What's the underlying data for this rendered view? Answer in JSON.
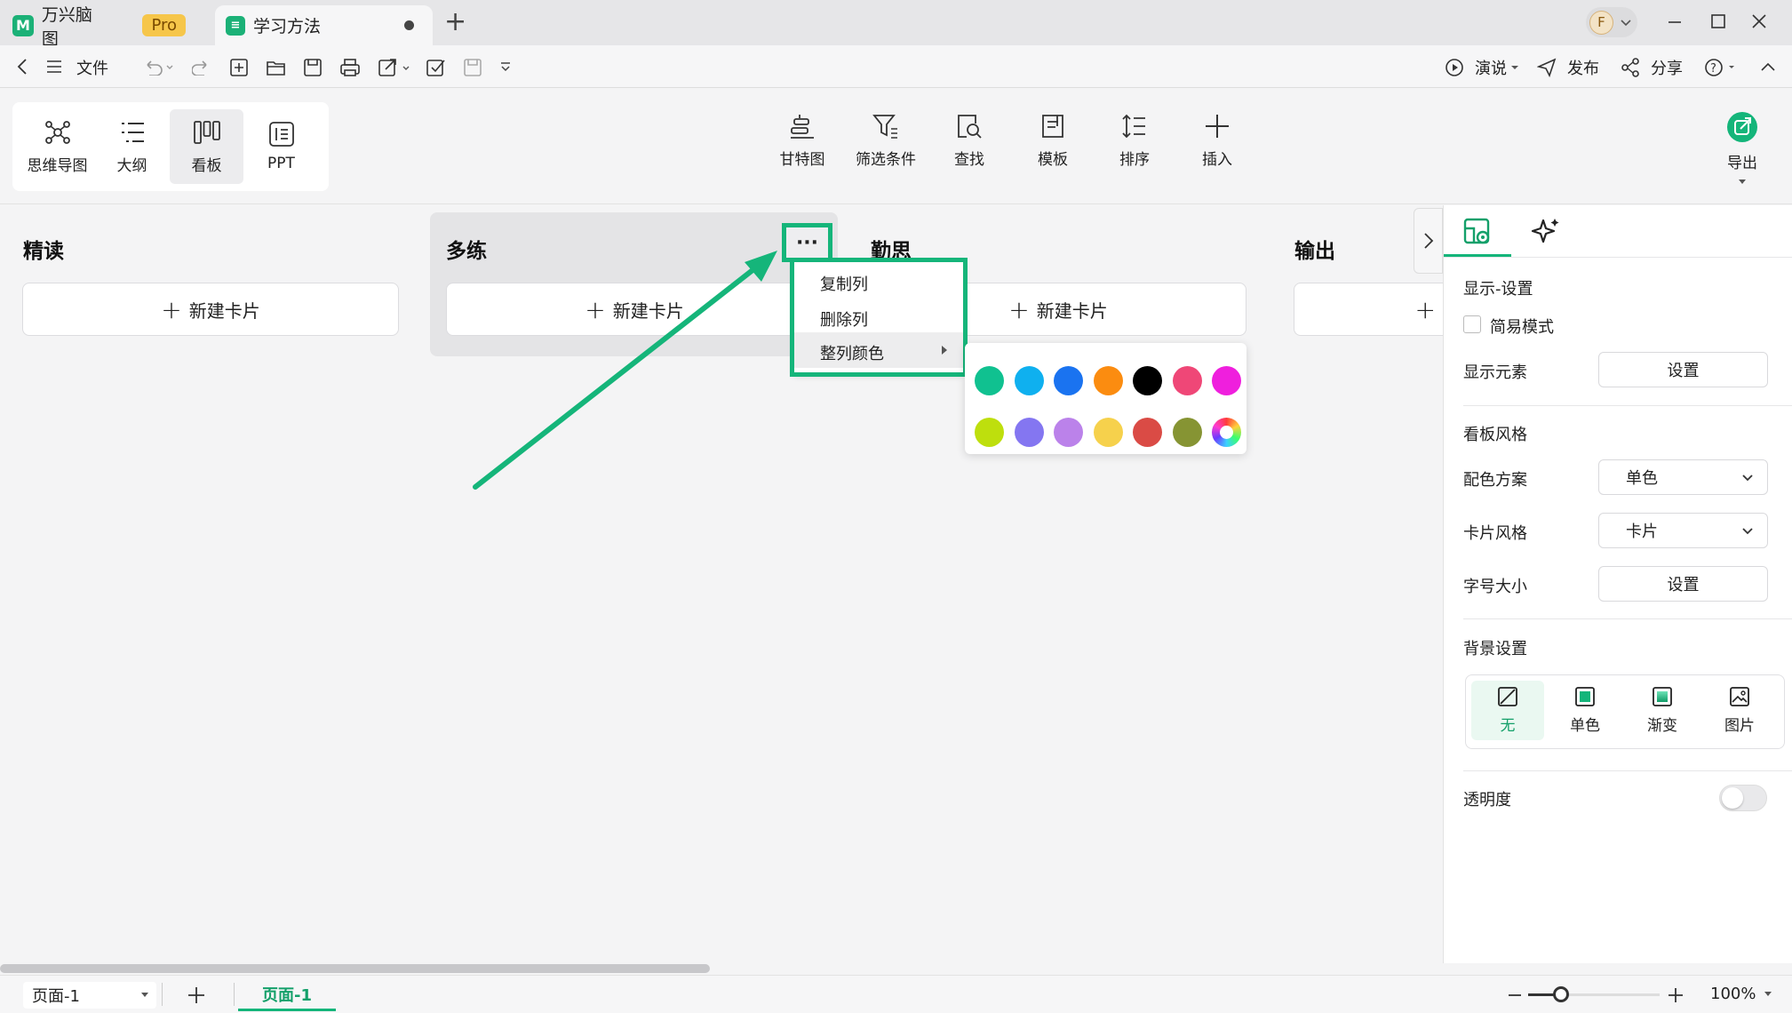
{
  "tabs": {
    "app_name": "万兴脑图",
    "pro_badge": "Pro",
    "doc_name": "学习方法",
    "new_tab": "+"
  },
  "avatar": {
    "letter": "F"
  },
  "toolbar": {
    "file_label": "文件",
    "present_label": "演说",
    "publish_label": "发布",
    "share_label": "分享"
  },
  "views": [
    {
      "label": "思维导图"
    },
    {
      "label": "大纲"
    },
    {
      "label": "看板"
    },
    {
      "label": "PPT"
    }
  ],
  "ribbon": {
    "gantt": "甘特图",
    "filter": "筛选条件",
    "find": "查找",
    "template": "模板",
    "sort": "排序",
    "insert": "插入",
    "export": "导出"
  },
  "board": {
    "columns": [
      {
        "title": "精读"
      },
      {
        "title": "多练"
      },
      {
        "title": "勤思"
      },
      {
        "title": "输出"
      }
    ],
    "new_card_label": "新建卡片",
    "more_icon": "···"
  },
  "column_menu": {
    "items": [
      {
        "label": "复制列"
      },
      {
        "label": "删除列"
      },
      {
        "label": "整列颜色"
      }
    ]
  },
  "color_palette": {
    "row1": [
      "#10c190",
      "#0fb0ef",
      "#1a73f0",
      "#fb8c10",
      "#000000",
      "#ef4777",
      "#ef1fdd"
    ],
    "row2": [
      "#bedf0d",
      "#8476f1",
      "#bb82ea",
      "#f6d14c",
      "#da4b45",
      "#869433",
      "rainbow"
    ]
  },
  "annotation": {
    "color": "#15b57a"
  },
  "panel": {
    "display_settings": "显示-设置",
    "simple_mode": "简易模式",
    "display_elements": "显示元素",
    "set_button": "设置",
    "board_style": "看板风格",
    "color_scheme_label": "配色方案",
    "color_scheme_value": "单色",
    "card_style_label": "卡片风格",
    "card_style_value": "卡片",
    "font_size_label": "字号大小",
    "background_settings": "背景设置",
    "bg_options": [
      {
        "label": "无"
      },
      {
        "label": "单色"
      },
      {
        "label": "渐变"
      },
      {
        "label": "图片"
      }
    ],
    "opacity_label": "透明度"
  },
  "status": {
    "page_select": "页面-1",
    "page_tab": "页面-1",
    "zoom": "100%"
  }
}
